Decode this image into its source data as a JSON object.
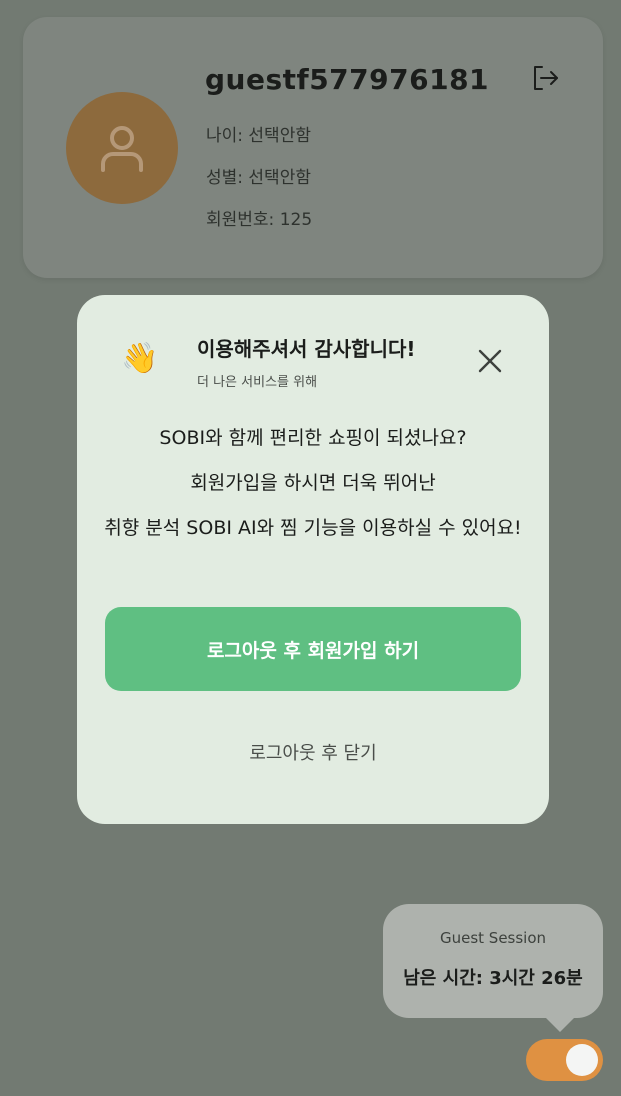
{
  "profile": {
    "username": "guestf577976181",
    "age_label": "나이: 선택안함",
    "gender_label": "성별: 선택안함",
    "member_label": "회원번호: 125",
    "avatar_icon": "user-icon",
    "logout_icon": "logout-icon"
  },
  "modal": {
    "title": "이용해주셔서 감사합니다!",
    "subtitle": "더 나은 서비스를 위해",
    "emoji": "👋",
    "message_lines": [
      "SOBI와 함께 편리한 쇼핑이 되셨나요?",
      "회원가입을 하시면 더욱 뛰어난",
      "취향 분석 SOBI AI와 찜 기능을 이용하실 수 있어요!"
    ],
    "primary_button": "로그아웃 후 회원가입 하기",
    "secondary_link": "로그아웃 후 닫기"
  },
  "session": {
    "title": "Guest Session",
    "remaining": "남은 시간: 3시간 26분"
  },
  "colors": {
    "accent_green": "#5fbf82",
    "toggle_orange": "#df9142",
    "avatar_brown": "#8d6a3d"
  }
}
